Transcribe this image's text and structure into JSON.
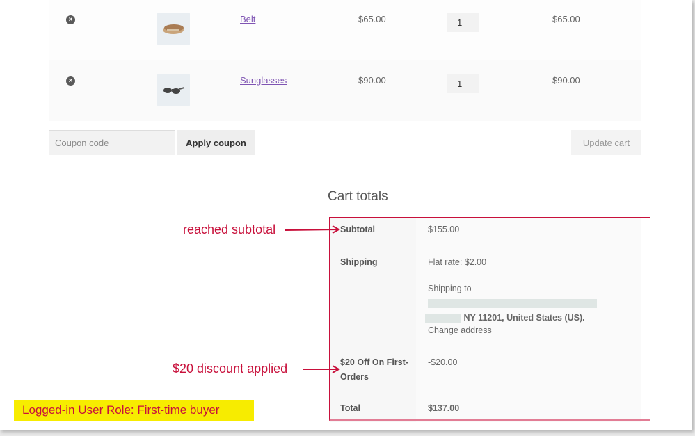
{
  "cart": {
    "items": [
      {
        "name": "Belt",
        "price": "$65.00",
        "quantity": "1",
        "subtotal": "$65.00",
        "thumbnail_icon": "belt-image",
        "remove_icon": "remove-item-icon"
      },
      {
        "name": "Sunglasses",
        "price": "$90.00",
        "quantity": "1",
        "subtotal": "$90.00",
        "thumbnail_icon": "sunglasses-image",
        "remove_icon": "remove-item-icon"
      }
    ],
    "coupon_placeholder": "Coupon code",
    "apply_coupon_label": "Apply coupon",
    "update_cart_label": "Update cart"
  },
  "totals": {
    "title": "Cart totals",
    "subtotal_label": "Subtotal",
    "subtotal_value": "$155.00",
    "shipping_label": "Shipping",
    "shipping_method": "Flat rate: $2.00",
    "shipping_to_prefix": "Shipping to",
    "shipping_address_tail": "NY 11201, United States (US).",
    "change_address_label": "Change address",
    "discount_label_line1": "$20 Off On First-",
    "discount_label_line2": "Orders",
    "discount_value": "-$20.00",
    "total_label": "Total",
    "total_value": "$137.00"
  },
  "annotations": {
    "subtotal_note": "reached subtotal",
    "discount_note": "$20 discount applied",
    "user_role": "Logged-in User Role: First-time buyer",
    "accent_color": "#c8103b",
    "highlight_color": "#f7ec00"
  }
}
